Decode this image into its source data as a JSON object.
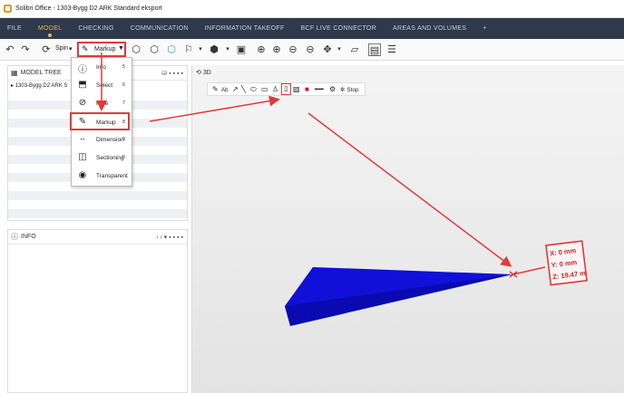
{
  "window": {
    "title": "Solibri Office - 1303-Bygg D2 ARK Standard eksport"
  },
  "menu": {
    "items": [
      {
        "label": "FILE",
        "active": false
      },
      {
        "label": "MODEL",
        "active": true
      },
      {
        "label": "CHECKING",
        "active": false
      },
      {
        "label": "COMMUNICATION",
        "active": false
      },
      {
        "label": "INFORMATION TAKEOFF",
        "active": false
      },
      {
        "label": "BCF LIVE CONNECTOR",
        "active": false
      },
      {
        "label": "AREAS AND VOLUMES",
        "active": false
      },
      {
        "label": "+",
        "active": false
      }
    ],
    "accent": "#e8b64a",
    "background": "#2e3a4a"
  },
  "toolbar": {
    "spin_label": "Spin",
    "markup_label": "Markup"
  },
  "model_tree": {
    "title": "MODEL TREE",
    "root_item": "1303-Bygg D2 ARK S"
  },
  "info_panel": {
    "title": "INFO"
  },
  "view": {
    "title": "3D",
    "stop_label": "Stop"
  },
  "dropdown": {
    "items": [
      {
        "label": "Info",
        "key": "5",
        "icon": "info-icon"
      },
      {
        "label": "Select",
        "key": "6",
        "icon": "select-icon"
      },
      {
        "label": "Hide",
        "key": "7",
        "icon": "hide-icon"
      },
      {
        "label": "Markup",
        "key": "8",
        "icon": "pencil-icon",
        "highlighted": true
      },
      {
        "label": "Dimension",
        "key": "9",
        "icon": "dimension-icon"
      },
      {
        "label": "Sectioning",
        "key": "0",
        "icon": "sectioning-icon"
      },
      {
        "label": "Transparent",
        "key": "",
        "icon": "eye-icon"
      }
    ]
  },
  "coordinates": {
    "x": "X: 0 mm",
    "y": "Y: 0 mm",
    "z": "Z: 19.47 m"
  },
  "colors": {
    "highlight": "#e03a3a",
    "model_shape": "#1010d8"
  }
}
